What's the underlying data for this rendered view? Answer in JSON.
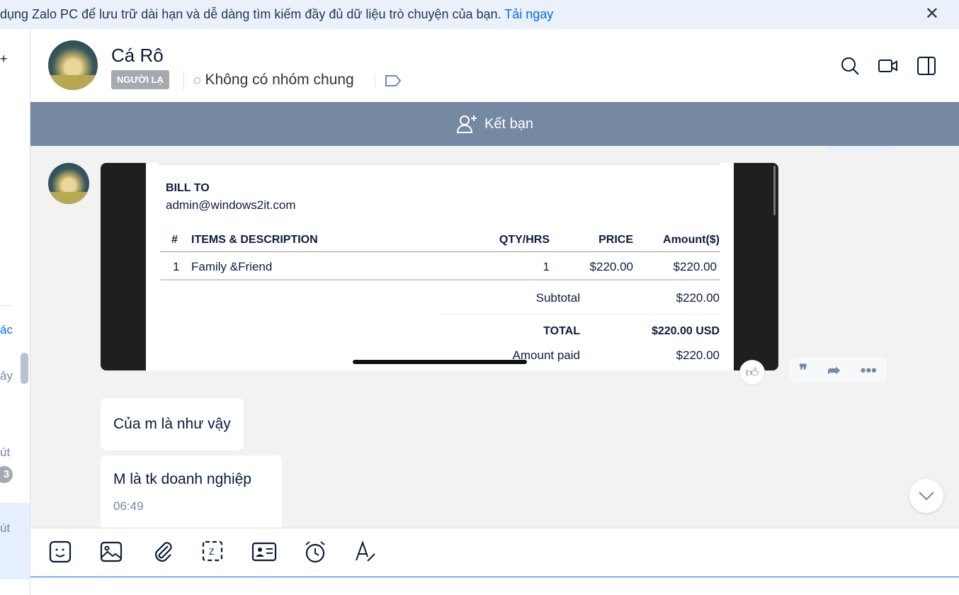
{
  "banner": {
    "text": "dụng Zalo PC để lưu trữ dài hạn và dễ dàng tìm kiếm đầy đủ dữ liệu trò chuyện của bạn.",
    "link": "Tải ngay"
  },
  "sidebar": {
    "items": [
      "ác",
      "ây",
      "út",
      "út"
    ],
    "badge": "3"
  },
  "header": {
    "name": "Cá Rô",
    "badge": "NGƯỜI LẠ",
    "groups": "Không có nhóm chung"
  },
  "add_friend": "Kết bạn",
  "invoice": {
    "bill_to_label": "BILL TO",
    "bill_to": "admin@windows2it.com",
    "columns": [
      "#",
      "ITEMS & DESCRIPTION",
      "QTY/HRS",
      "PRICE",
      "Amount($)"
    ],
    "rows": [
      [
        "1",
        "Family &Friend",
        "1",
        "$220.00",
        "$220.00"
      ]
    ],
    "subtotal_label": "Subtotal",
    "subtotal": "$220.00",
    "total_label": "TOTAL",
    "total": "$220.00 USD",
    "paid_label": "Amount paid",
    "paid": "$220.00"
  },
  "messages": [
    {
      "text": "Của m là như vậy"
    },
    {
      "text": "M là tk doanh nghiệp",
      "time": "06:49"
    }
  ]
}
